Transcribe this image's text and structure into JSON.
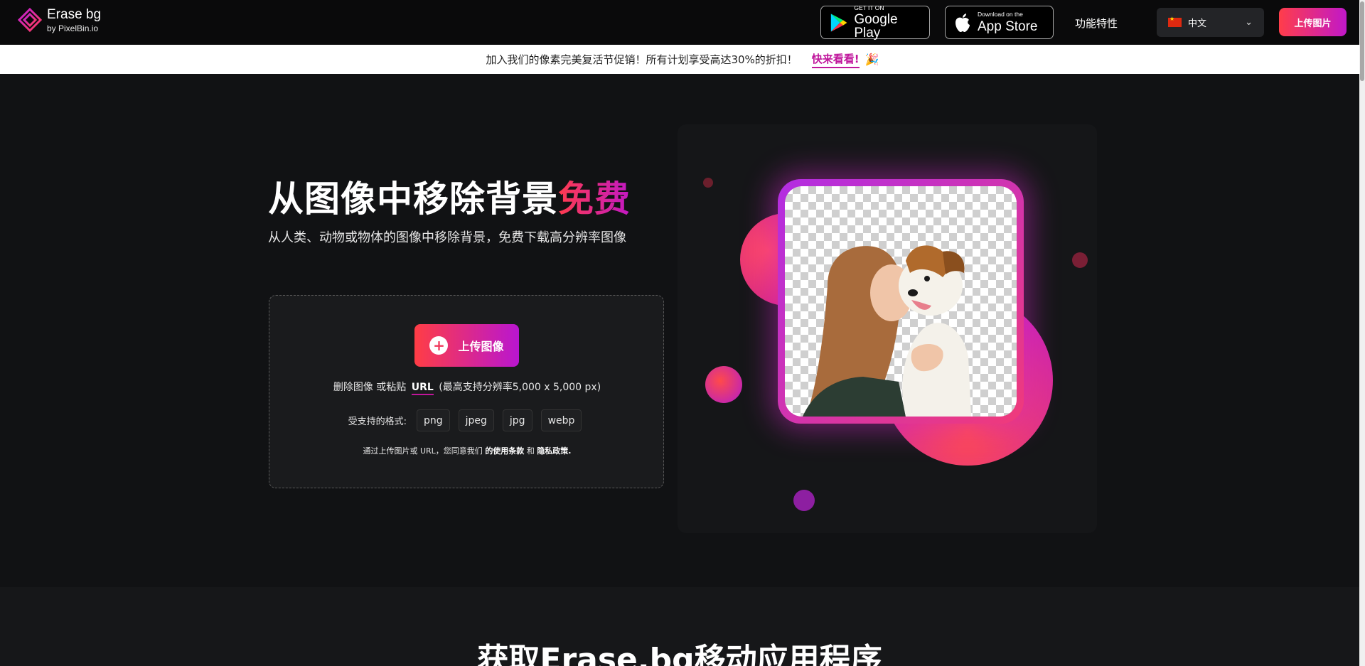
{
  "header": {
    "logo_title": "Erase bg",
    "logo_subtitle": "by PixelBin.io",
    "google_play": {
      "small": "GET IT ON",
      "big": "Google Play"
    },
    "app_store": {
      "small": "Download on the",
      "big": "App Store"
    },
    "features_label": "功能特性",
    "language": {
      "selected": "中文",
      "flag": "cn-flag-icon"
    },
    "upload_label": "上传图片"
  },
  "promo": {
    "text": "加入我们的像素完美复活节促销！所有计划享受高达30%的折扣！",
    "link_label": "快来看看!",
    "icon": "party-popper-icon"
  },
  "hero": {
    "title_main": "从图像中移除背景",
    "title_accent": "免费",
    "subtitle": "从人类、动物或物体的图像中移除背景，免费下载高分辨率图像"
  },
  "upload_box": {
    "button_label": "上传图像",
    "paste_prefix": "删除图像 或粘贴",
    "url_label": "URL",
    "paste_suffix": "(最高支持分辨率5,000 x 5,000 px)",
    "formats_label": "受支持的格式:",
    "formats": [
      "png",
      "jpeg",
      "jpg",
      "webp"
    ],
    "terms_prefix": "通过上传图片或 URL，您同意我们",
    "terms_link": "的使用条款",
    "terms_and": "和",
    "privacy_link": "隐私政策."
  },
  "bottom": {
    "title": "获取Erase.bg移动应用程序"
  },
  "colors": {
    "accent_red": "#ff3d4a",
    "accent_purple": "#c118c9",
    "background": "#111214"
  }
}
